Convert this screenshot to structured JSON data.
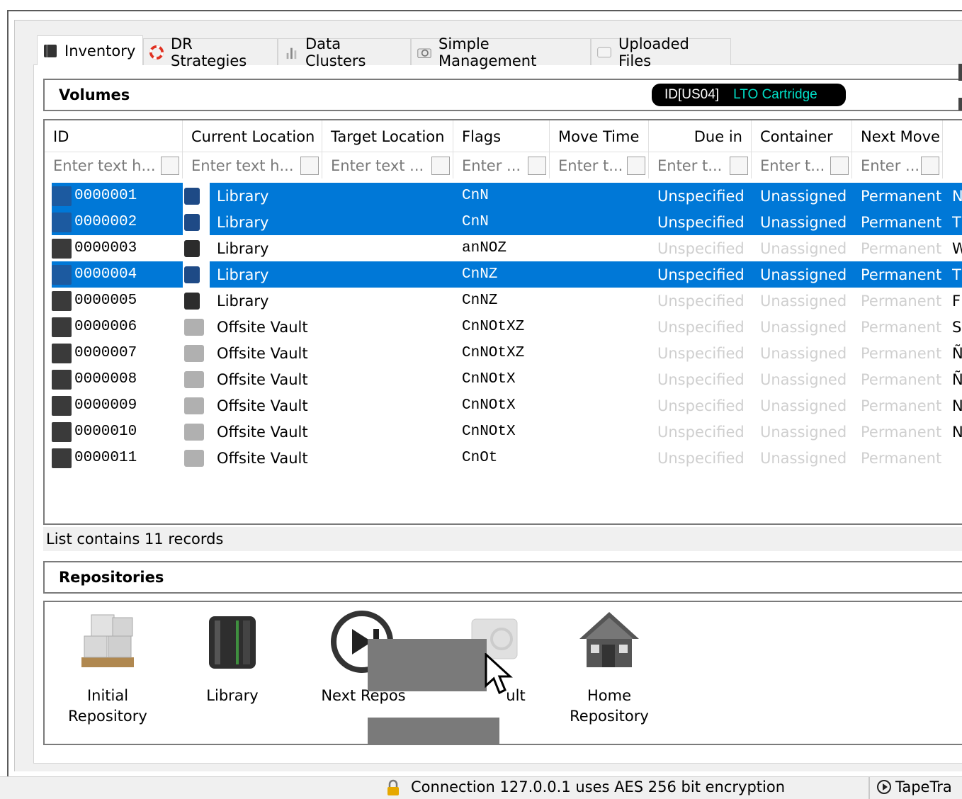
{
  "tabs": [
    {
      "label": "Inventory",
      "icon": "tape-icon",
      "active": true
    },
    {
      "label": "DR Strategies",
      "icon": "lifebuoy-icon",
      "active": false
    },
    {
      "label": "Data Clusters",
      "icon": "data-cluster-icon",
      "active": false
    },
    {
      "label": "Simple Management",
      "icon": "camera-icon",
      "active": false
    },
    {
      "label": "Uploaded Files",
      "icon": "window-icon",
      "active": false
    }
  ],
  "volumes": {
    "title": "Volumes",
    "badge": {
      "id": "ID[US04]",
      "type": "LTO Cartridge"
    },
    "columns": [
      "ID",
      "Current Location",
      "Target Location",
      "Flags",
      "Move Time",
      "Due in",
      "Container",
      "Next Move"
    ],
    "filter_placeholders": [
      "Enter text h...",
      "Enter text h...",
      "Enter text ...",
      "Enter ...",
      "Enter t...",
      "Enter t...",
      "Enter t...",
      "Enter ..."
    ],
    "rows": [
      {
        "id": "0000001",
        "location": "Library",
        "loc_icon": "library-icon",
        "flags": "CnN",
        "due": "Unspecified",
        "container": "Unassigned",
        "next": "Permanent",
        "extra": "N",
        "selected": true
      },
      {
        "id": "0000002",
        "location": "Library",
        "loc_icon": "library-icon",
        "flags": "CnN",
        "due": "Unspecified",
        "container": "Unassigned",
        "next": "Permanent",
        "extra": "T",
        "selected": true
      },
      {
        "id": "0000003",
        "location": "Library",
        "loc_icon": "library-icon",
        "flags": "anNOZ",
        "due": "Unspecified",
        "container": "Unassigned",
        "next": "Permanent",
        "extra": "W",
        "selected": false
      },
      {
        "id": "0000004",
        "location": "Library",
        "loc_icon": "library-icon",
        "flags": "CnNZ",
        "due": "Unspecified",
        "container": "Unassigned",
        "next": "Permanent",
        "extra": "T",
        "selected": true
      },
      {
        "id": "0000005",
        "location": "Library",
        "loc_icon": "library-icon",
        "flags": "CnNZ",
        "due": "Unspecified",
        "container": "Unassigned",
        "next": "Permanent",
        "extra": "F",
        "selected": false
      },
      {
        "id": "0000006",
        "location": "Offsite Vault",
        "loc_icon": "vault-icon",
        "flags": "CnNOtXZ",
        "due": "Unspecified",
        "container": "Unassigned",
        "next": "Permanent",
        "extra": "S",
        "selected": false
      },
      {
        "id": "0000007",
        "location": "Offsite Vault",
        "loc_icon": "vault-icon",
        "flags": "CnNOtXZ",
        "due": "Unspecified",
        "container": "Unassigned",
        "next": "Permanent",
        "extra": "Ñ",
        "selected": false
      },
      {
        "id": "0000008",
        "location": "Offsite Vault",
        "loc_icon": "vault-icon",
        "flags": "CnNOtX",
        "due": "Unspecified",
        "container": "Unassigned",
        "next": "Permanent",
        "extra": "Ñ",
        "selected": false
      },
      {
        "id": "0000009",
        "location": "Offsite Vault",
        "loc_icon": "vault-icon",
        "flags": "CnNOtX",
        "due": "Unspecified",
        "container": "Unassigned",
        "next": "Permanent",
        "extra": "N",
        "selected": false
      },
      {
        "id": "0000010",
        "location": "Offsite Vault",
        "loc_icon": "vault-icon",
        "flags": "CnNOtX",
        "due": "Unspecified",
        "container": "Unassigned",
        "next": "Permanent",
        "extra": "N",
        "selected": false
      },
      {
        "id": "0000011",
        "location": "Offsite Vault",
        "loc_icon": "vault-icon",
        "flags": "CnOt",
        "due": "Unspecified",
        "container": "Unassigned",
        "next": "Permanent",
        "extra": "",
        "selected": false
      }
    ],
    "record_count": "List contains 11 records"
  },
  "repositories": {
    "title": "Repositories",
    "items": [
      {
        "line1": "Initial",
        "line2": "Repository",
        "icon": "boxes-icon"
      },
      {
        "line1": "Library",
        "line2": "",
        "icon": "library-icon"
      },
      {
        "line1": "Next Repos",
        "line2": "",
        "icon": "next-icon"
      },
      {
        "line1": "ult",
        "line2": "",
        "icon": "vault-icon"
      },
      {
        "line1": "Home",
        "line2": "Repository",
        "icon": "house-icon"
      }
    ]
  },
  "statusbar": {
    "connection": "Connection 127.0.0.1 uses AES 256 bit encryption",
    "app": "TapeTra"
  },
  "colors": {
    "selection": "#0078d7",
    "badge_bg": "#000000",
    "badge_type": "#00e0c8",
    "dim_text": "#cfcfcf"
  }
}
